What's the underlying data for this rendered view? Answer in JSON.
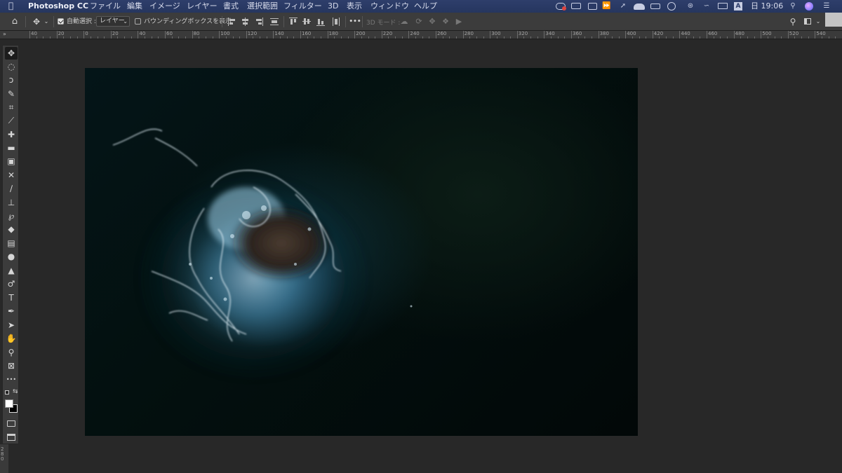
{
  "menubar": {
    "apple_icon": "apple-icon",
    "app_name": "Photoshop CC",
    "items": [
      "ファイル",
      "編集",
      "イメージ",
      "レイヤー",
      "書式",
      "選択範囲",
      "フィルター",
      "3D",
      "表示",
      "ウィンドウ",
      "ヘルプ"
    ],
    "keyboard_indicator": "A",
    "clock": "日 19:06"
  },
  "options_bar": {
    "auto_select_label": "自動選択 :",
    "auto_select_checked": true,
    "auto_select_target": "レイヤー",
    "bounding_box_label": "バウンディングボックスを表示",
    "bounding_box_checked": false,
    "more": "•••",
    "mode_3d_label": "3D モード :"
  },
  "ruler": {
    "labels": [
      "40",
      "20",
      "0",
      "20",
      "40",
      "60",
      "80",
      "100",
      "120",
      "140",
      "160",
      "180",
      "200",
      "220",
      "240",
      "260",
      "280",
      "300",
      "320",
      "340",
      "360",
      "380",
      "400",
      "420",
      "440",
      "460",
      "480",
      "500",
      "520",
      "540"
    ]
  },
  "vertical_ruler_label": "280",
  "toolbar": {
    "collapse": "»",
    "tools": [
      {
        "name": "move-tool",
        "glyph": "✥"
      },
      {
        "name": "marquee-tool",
        "glyph": "◌"
      },
      {
        "name": "lasso-tool",
        "glyph": "ↄ"
      },
      {
        "name": "quick-select-tool",
        "glyph": "✎"
      },
      {
        "name": "crop-tool",
        "glyph": "⌗"
      },
      {
        "name": "eyedropper-tool",
        "glyph": "⟋"
      },
      {
        "name": "spot-healing-tool",
        "glyph": "✚"
      },
      {
        "name": "healing-brush-tool",
        "glyph": "▬"
      },
      {
        "name": "patch-tool",
        "glyph": "▣"
      },
      {
        "name": "content-aware-move-tool",
        "glyph": "✕"
      },
      {
        "name": "brush-tool",
        "glyph": "∕"
      },
      {
        "name": "clone-stamp-tool",
        "glyph": "⊥"
      },
      {
        "name": "history-brush-tool",
        "glyph": "℘"
      },
      {
        "name": "eraser-tool",
        "glyph": "◆"
      },
      {
        "name": "gradient-tool",
        "glyph": "▤"
      },
      {
        "name": "blur-tool",
        "glyph": "●"
      },
      {
        "name": "sharpen-tool",
        "glyph": "▲"
      },
      {
        "name": "dodge-tool",
        "glyph": "♂"
      },
      {
        "name": "type-tool",
        "glyph": "T"
      },
      {
        "name": "pen-tool",
        "glyph": "✒"
      },
      {
        "name": "path-select-tool",
        "glyph": "➤"
      },
      {
        "name": "hand-tool",
        "glyph": "✋"
      },
      {
        "name": "zoom-tool",
        "glyph": "⚲"
      },
      {
        "name": "frame-tool",
        "glyph": "⊠"
      },
      {
        "name": "extras-tool",
        "glyph": "•••"
      }
    ],
    "foreground_color": "#ffffff",
    "background_color": "#000000"
  },
  "colors": {
    "menubar": "#2b3b68",
    "panel": "#3c3c3c",
    "workspace": "#282828"
  }
}
